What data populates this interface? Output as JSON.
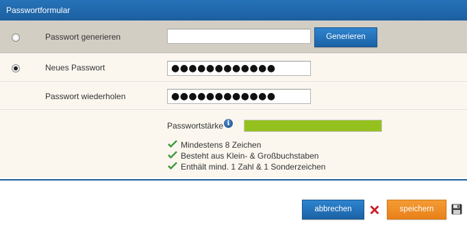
{
  "form": {
    "title": "Passwortformular",
    "generate": {
      "label": "Passwort generieren",
      "value": "",
      "button_label": "Generieren",
      "selected": false
    },
    "new_password": {
      "label": "Neues Passwort",
      "value": "●●●●●●●●●●●●",
      "selected": true
    },
    "repeat_password": {
      "label": "Passwort wiederholen",
      "value": "●●●●●●●●●●●●"
    },
    "strength": {
      "label": "Passwortstärke",
      "info_icon": "info-icon",
      "level": 1.0,
      "color": "#95c11f",
      "rules": [
        {
          "text": "Mindestens 8 Zeichen",
          "icon": "checkmark-icon",
          "color": "#3f9a3f"
        },
        {
          "text": "Besteht aus Klein- & Großbuchstaben",
          "icon": "checkmark-icon",
          "color": "#3f9a3f"
        },
        {
          "text": "Enthält mind. 1 Zahl & 1 Sonderzeichen",
          "icon": "checkmark-icon",
          "color": "#3f9a3f"
        }
      ]
    }
  },
  "actions": {
    "cancel_label": "abbrechen",
    "save_label": "speichern",
    "cancel_icon": "close-icon",
    "save_icon": "floppy-disk-icon"
  },
  "colors": {
    "header_blue": "#1b5fa0",
    "button_blue": "#1b62a6",
    "button_orange": "#ee8a22",
    "row_highlight": "#d3cec4",
    "row_bg": "#fbf7ef"
  }
}
